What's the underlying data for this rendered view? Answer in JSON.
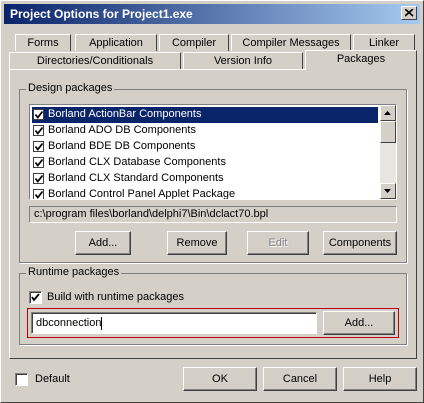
{
  "window": {
    "title": "Project Options for Project1.exe"
  },
  "tabs": {
    "row1": [
      "Forms",
      "Application",
      "Compiler",
      "Compiler Messages",
      "Linker"
    ],
    "row2": [
      "Directories/Conditionals",
      "Version Info",
      "Packages"
    ],
    "active": "Packages"
  },
  "design_packages": {
    "label": "Design packages",
    "items": [
      {
        "label": "Borland ActionBar Components",
        "checked": true,
        "selected": true
      },
      {
        "label": "Borland ADO DB Components",
        "checked": true,
        "selected": false
      },
      {
        "label": "Borland BDE DB Components",
        "checked": true,
        "selected": false
      },
      {
        "label": "Borland CLX Database Components",
        "checked": true,
        "selected": false
      },
      {
        "label": "Borland CLX Standard Components",
        "checked": true,
        "selected": false
      },
      {
        "label": "Borland Control Panel Applet Package",
        "checked": true,
        "selected": false
      }
    ],
    "path": "c:\\program files\\borland\\delphi7\\Bin\\dclact70.bpl",
    "buttons": {
      "add": "Add...",
      "remove": "Remove",
      "edit": "Edit",
      "components": "Components"
    }
  },
  "runtime_packages": {
    "label": "Runtime packages",
    "build_with_label": "Build with runtime packages",
    "build_with_checked": true,
    "input_value": "dbconnection",
    "add_button": "Add..."
  },
  "footer": {
    "default_label": "Default",
    "default_checked": false,
    "ok": "OK",
    "cancel": "Cancel",
    "help": "Help"
  }
}
